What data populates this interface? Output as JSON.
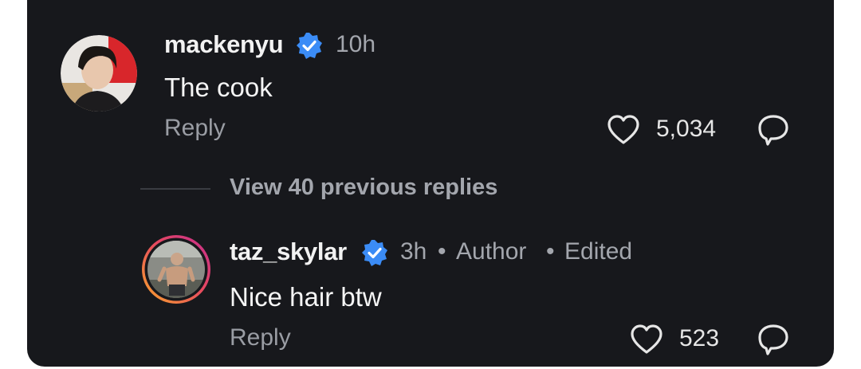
{
  "comment": {
    "username": "mackenyu",
    "time": "10h",
    "text": "The cook",
    "reply_label": "Reply",
    "likes": "5,034",
    "avatar_icon": "profile-photo",
    "verified_icon": "verified-badge-icon"
  },
  "view_replies": {
    "label": "View 40 previous replies"
  },
  "reply": {
    "username": "taz_skylar",
    "time": "3h",
    "author_label": "Author",
    "edited_label": "Edited",
    "separator": "•",
    "text": "Nice hair btw",
    "reply_label": "Reply",
    "likes": "523",
    "avatar_icon": "profile-photo-story-ring",
    "verified_icon": "verified-badge-icon"
  },
  "colors": {
    "background": "#17181c",
    "verified": "#3b8cf6",
    "story_ring_start": "#f9a72b",
    "story_ring_end": "#d22f8c"
  }
}
